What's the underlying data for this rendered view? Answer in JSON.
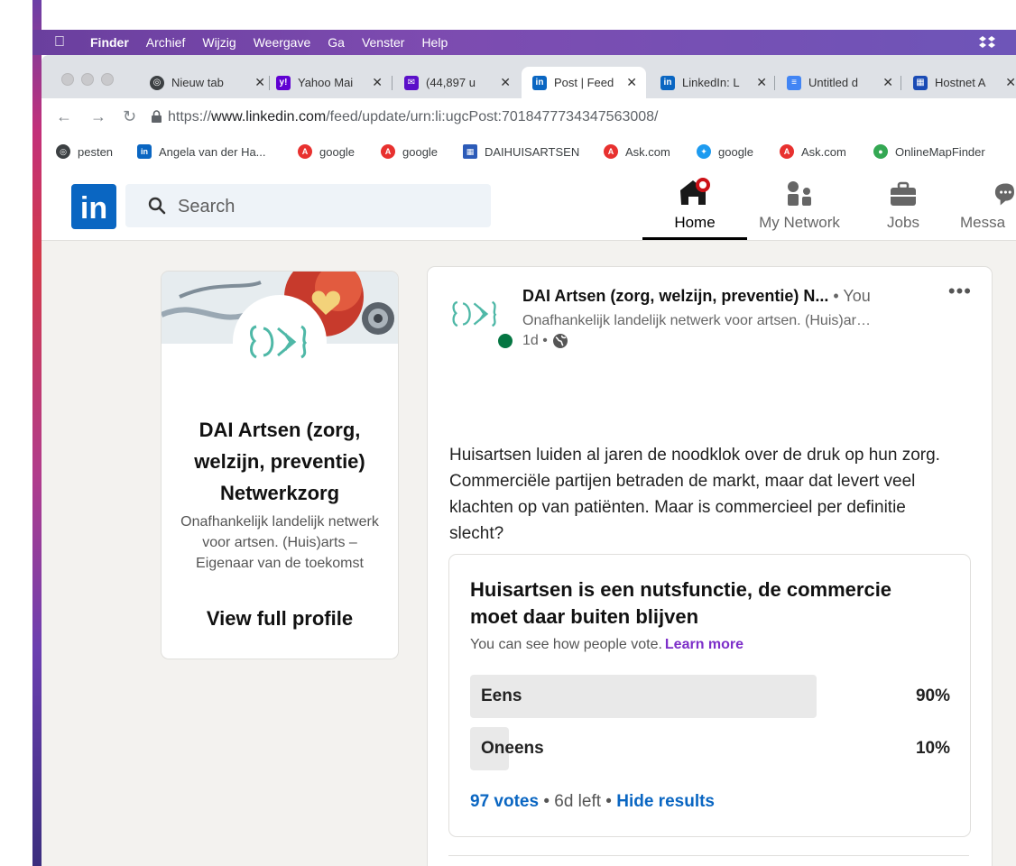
{
  "menubar": {
    "app": "Finder",
    "items": [
      "Archief",
      "Wijzig",
      "Weergave",
      "Ga",
      "Venster",
      "Help"
    ]
  },
  "tabs": [
    {
      "title": "Nieuw tab",
      "icon": "chrome-icon",
      "color": "#3c4043"
    },
    {
      "title": "Yahoo Mai",
      "icon": "yahoo-icon",
      "color": "#6001d2"
    },
    {
      "title": "(44,897 u",
      "icon": "mail-icon",
      "color": "#5b0fc9"
    },
    {
      "title": "Post | Feed",
      "icon": "linkedin-icon",
      "color": "#0a66c2"
    },
    {
      "title": "LinkedIn: L",
      "icon": "linkedin-icon",
      "color": "#0a66c2"
    },
    {
      "title": "Untitled d",
      "icon": "docs-icon",
      "color": "#4285f4"
    },
    {
      "title": "Hostnet A",
      "icon": "hostnet-icon",
      "color": "#1a4bb5"
    }
  ],
  "address": {
    "url_prefix": "https://",
    "url_host": "www.linkedin.com",
    "url_path": "/feed/update/urn:li:ugcPost:7018477734347563008/"
  },
  "bookmarks": [
    {
      "label": "pesten",
      "icon": "chrome-icon",
      "color": "#3c4043"
    },
    {
      "label": "Angela van der Ha...",
      "icon": "linkedin-icon",
      "color": "#0a66c2"
    },
    {
      "label": "google",
      "icon": "ask-icon",
      "color": "#e8312f"
    },
    {
      "label": "google",
      "icon": "ask-icon",
      "color": "#e8312f"
    },
    {
      "label": "DAIHUISARTSEN",
      "icon": "grid-icon",
      "color": "#2c5bb8"
    },
    {
      "label": "Ask.com",
      "icon": "ask-icon",
      "color": "#e8312f"
    },
    {
      "label": "google",
      "icon": "twitter-icon",
      "color": "#1d9bf0"
    },
    {
      "label": "Ask.com",
      "icon": "ask-icon",
      "color": "#e8312f"
    },
    {
      "label": "OnlineMapFinder",
      "icon": "map-pin-icon",
      "color": "#34a853"
    }
  ],
  "linkedin": {
    "search_placeholder": "Search",
    "nav": [
      {
        "label": "Home",
        "icon": "home-icon",
        "active": true
      },
      {
        "label": "My Network",
        "icon": "network-icon",
        "active": false
      },
      {
        "label": "Jobs",
        "icon": "briefcase-icon",
        "active": false
      },
      {
        "label": "Messa",
        "icon": "messaging-icon",
        "active": false
      }
    ]
  },
  "profile": {
    "name": "DAI Artsen (zorg, welzijn, preventie) Netwerkzorg",
    "description": "Onafhankelijk landelijk netwerk voor artsen. (Huis)arts – Eigenaar van de toekomst",
    "view_label": "View full profile"
  },
  "post": {
    "author": "DAI Artsen (zorg, welzijn, preventie) N...",
    "you": "• You",
    "headline": "Onafhankelijk landelijk netwerk voor artsen. (Huis)ar…",
    "time": "1d •",
    "more": "•••",
    "text": "Huisartsen luiden al jaren de noodklok over de druk op hun zorg. Commerciële partijen betraden de markt, maar dat levert veel klachten op van patiënten. Maar is commercieel per definitie slecht?",
    "poll": {
      "question": "Huisartsen is een nutsfunctie, de commercie moet daar buiten blijven",
      "note": "You can see how people vote.",
      "learn_more": "Learn more",
      "options": [
        {
          "label": "Eens",
          "percent": "90%",
          "fraction": 0.9
        },
        {
          "label": "Oneens",
          "percent": "10%",
          "fraction": 0.1
        }
      ],
      "votes": "97 votes",
      "time_left": "• 6d left •",
      "hide": "Hide results"
    }
  }
}
